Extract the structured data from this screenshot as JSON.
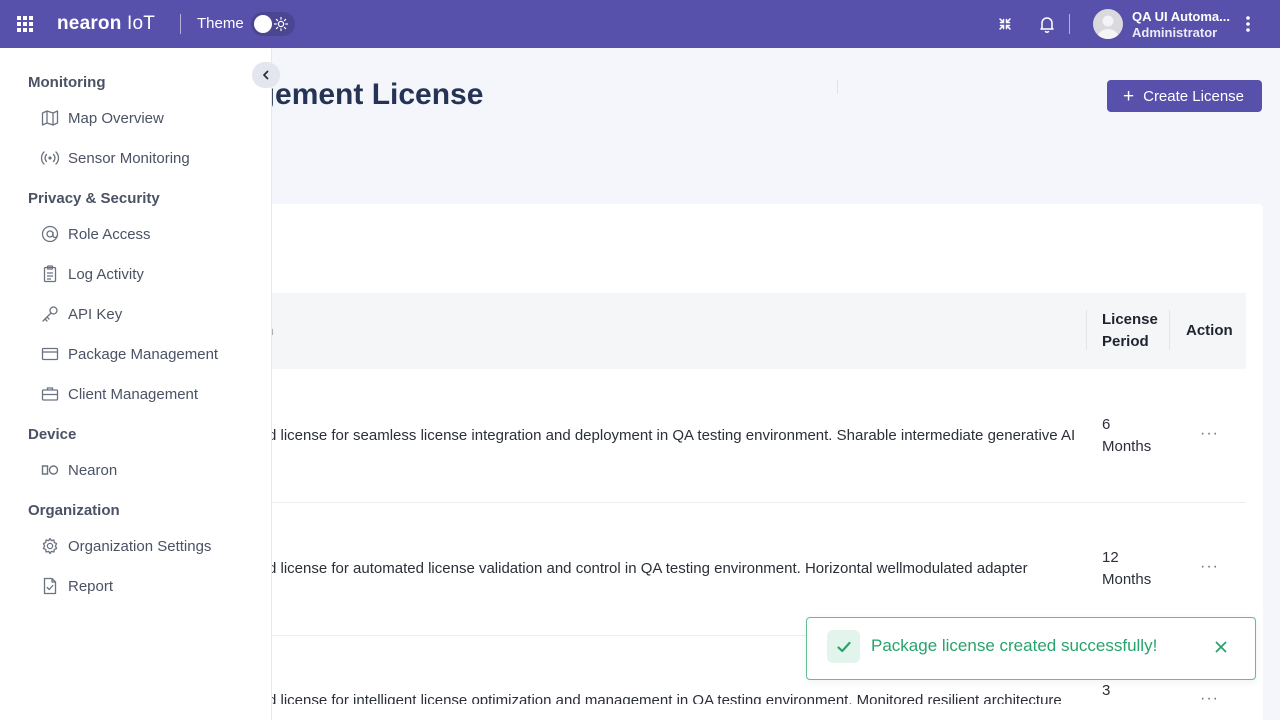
{
  "topbar": {
    "brand": "nearon",
    "brand_suffix": " IoT",
    "theme_label": "Theme",
    "user_name": "QA UI Automa...",
    "user_role": "Administrator",
    "bg_color": "#5751ab"
  },
  "sidebar": {
    "sections": [
      {
        "title": "Monitoring",
        "items": [
          {
            "label": "Map Overview",
            "icon": "map-icon"
          },
          {
            "label": "Sensor Monitoring",
            "icon": "broadcast-icon"
          }
        ]
      },
      {
        "title": "Privacy & Security",
        "items": [
          {
            "label": "Role Access",
            "icon": "at-sign-icon"
          },
          {
            "label": "Log Activity",
            "icon": "clipboard-icon"
          },
          {
            "label": "API Key",
            "icon": "key-icon"
          },
          {
            "label": "Package Management",
            "icon": "card-icon"
          },
          {
            "label": "Client Management",
            "icon": "briefcase-icon"
          }
        ]
      },
      {
        "title": "Device",
        "items": [
          {
            "label": "Nearon",
            "icon": "nearon-device-icon"
          }
        ]
      },
      {
        "title": "Organization",
        "items": [
          {
            "label": "Organization Settings",
            "icon": "gear-icon"
          },
          {
            "label": "Report",
            "icon": "file-check-icon"
          }
        ]
      }
    ]
  },
  "main": {
    "title": "Management License",
    "create_button": "Create License",
    "table": {
      "headers": {
        "description": "on",
        "period": "License Period",
        "action": "Action"
      },
      "rows": [
        {
          "description": "d license for seamless license integration and deployment in QA testing environment. Sharable intermediate generative AI",
          "period": "6 Months",
          "action": "···"
        },
        {
          "description": "d license for automated license validation and control in QA testing environment. Horizontal wellmodulated adapter",
          "period": "12 Months",
          "action": "···"
        },
        {
          "description": "d license for intelligent license optimization and management in QA testing environment. Monitored resilient architecture",
          "period": "3",
          "action": "···"
        }
      ]
    }
  },
  "toast": {
    "message": "Package license created successfully!",
    "color": "#27a36c"
  }
}
